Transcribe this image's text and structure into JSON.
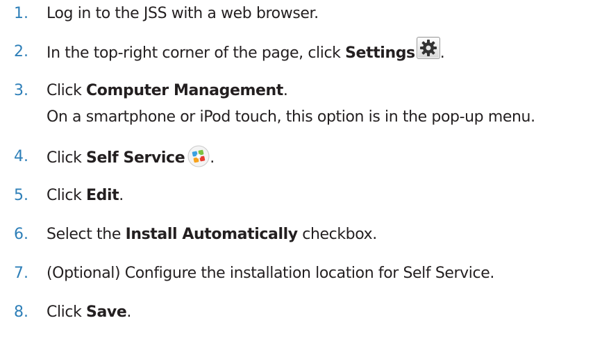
{
  "steps": [
    {
      "number": "1.",
      "parts": [
        "Log in to the JSS with a web browser."
      ]
    },
    {
      "number": "2.",
      "before": "In the top-right corner of the page, click ",
      "bold": "Settings",
      "icon": "gear-icon",
      "after": "."
    },
    {
      "number": "3.",
      "before": "Click ",
      "bold": "Computer Management",
      "after": ".",
      "note": "On a smartphone or iPod touch, this option is in the pop-up menu."
    },
    {
      "number": "4.",
      "before": "Click ",
      "bold": "Self Service",
      "icon": "self-service-icon",
      "after": "."
    },
    {
      "number": "5.",
      "before": "Click ",
      "bold": "Edit",
      "after": "."
    },
    {
      "number": "6.",
      "before": "Select the ",
      "bold": "Install Automatically",
      "after": " checkbox."
    },
    {
      "number": "7.",
      "parts": [
        "(Optional) Configure the installation location for Self Service."
      ]
    },
    {
      "number": "8.",
      "before": "Click ",
      "bold": "Save",
      "after": "."
    }
  ],
  "colors": {
    "step_number": "#2e7fb8",
    "body_text": "#231f20"
  }
}
